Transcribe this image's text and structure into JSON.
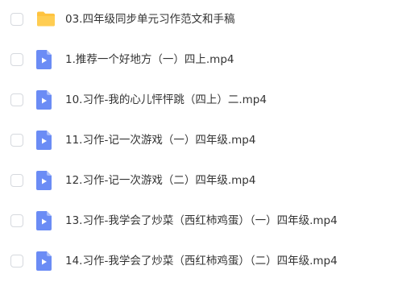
{
  "colors": {
    "folder": "#ffc33f",
    "video": "#6b8cf5",
    "text": "#333333",
    "checkbox_border": "#d6d9de"
  },
  "files": [
    {
      "name": "03.四年级同步单元习作范文和手稿",
      "type": "folder",
      "icon": "folder-icon",
      "checked": false
    },
    {
      "name": "1.推荐一个好地方（一）四上.mp4",
      "type": "video",
      "icon": "video-file-icon",
      "checked": false
    },
    {
      "name": "10.习作-我的心儿怦怦跳（四上）二.mp4",
      "type": "video",
      "icon": "video-file-icon",
      "checked": false
    },
    {
      "name": "11.习作-记一次游戏（一）四年级.mp4",
      "type": "video",
      "icon": "video-file-icon",
      "checked": false
    },
    {
      "name": "12.习作-记一次游戏（二）四年级.mp4",
      "type": "video",
      "icon": "video-file-icon",
      "checked": false
    },
    {
      "name": "13.习作-我学会了炒菜（西红柿鸡蛋）（一）四年级.mp4",
      "type": "video",
      "icon": "video-file-icon",
      "checked": false
    },
    {
      "name": "14.习作-我学会了炒菜（西红柿鸡蛋）（二）四年级.mp4",
      "type": "video",
      "icon": "video-file-icon",
      "checked": false
    }
  ]
}
